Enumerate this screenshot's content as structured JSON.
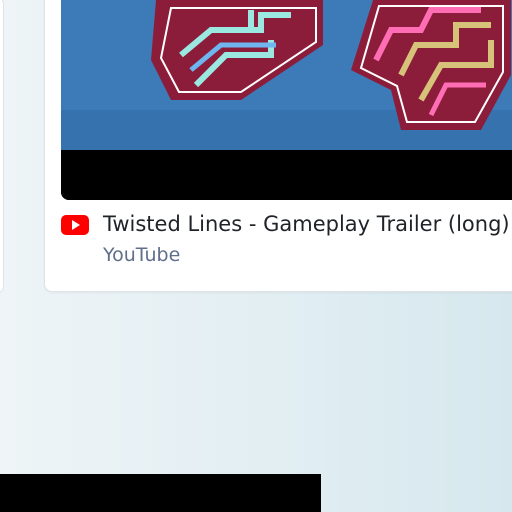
{
  "embed": {
    "title": "Twisted Lines - Gameplay Trailer (long)",
    "source": "YouTube",
    "source_icon": "youtube-logo-icon",
    "thumbnail_scene": "game-tiles"
  },
  "colors": {
    "youtube_red": "#ff0000",
    "link_gray": "#5f6e8a",
    "title_text": "#1f2328",
    "thumb_blue": "#3d7bb8"
  }
}
